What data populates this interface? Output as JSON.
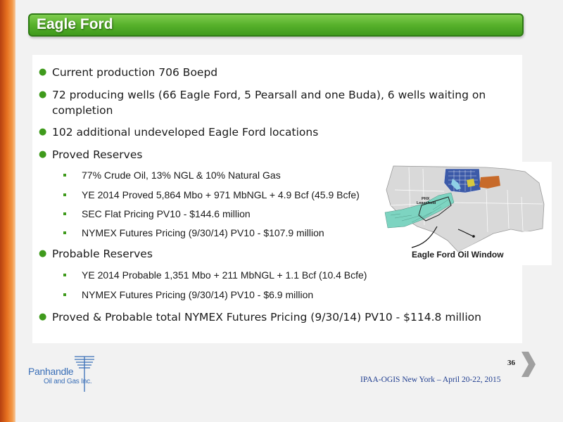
{
  "slide": {
    "title": "Eagle Ford",
    "page_number": "36",
    "footer": "IPAA-OGIS New York – April 20-22, 2015"
  },
  "bullets": {
    "b1": "Current production 706 Boepd",
    "b2_line1": "72 producing wells (66 Eagle Ford, 5 Pearsall and one Buda), 6 wells waiting on",
    "b2_line2": "completion",
    "b3": "102 additional undeveloped Eagle Ford locations",
    "b4": "Proved Reserves",
    "b4_subs": [
      "77% Crude Oil, 13% NGL & 10% Natural Gas",
      "YE 2014 Proved 5,864 Mbo + 971 MbNGL + 4.9 Bcf (45.9 Bcfe)",
      "SEC Flat Pricing PV10 - $144.6 million",
      "NYMEX Futures Pricing (9/30/14) PV10 - $107.9 million"
    ],
    "b5": "Probable Reserves",
    "b5_subs": [
      "YE 2014 Probable 1,351 Mbo + 211 MbNGL + 1.1 Bcf (10.4 Bcfe)",
      "NYMEX Futures Pricing (9/30/14) PV10 - $6.9 million"
    ],
    "b6": "Proved & Probable total NYMEX Futures Pricing (9/30/14) PV10 - $114.8 million"
  },
  "map": {
    "caption": "Eagle Ford Oil Window",
    "label_line1": "PHX",
    "label_line2": "Leasehold"
  },
  "logo": {
    "word1": "Panhandle",
    "word2": "Oil and Gas Inc."
  },
  "colors": {
    "accent_green": "#57b12b",
    "footer_blue": "#1f3d8f",
    "logo_blue": "#3a6fb7",
    "strip_orange": "#e6701f"
  }
}
